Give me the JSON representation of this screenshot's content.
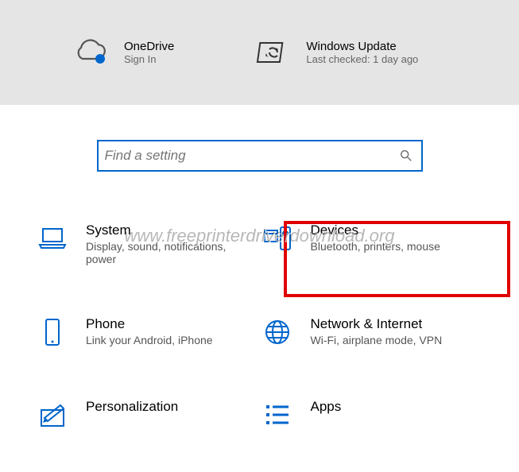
{
  "top": {
    "onedrive": {
      "title": "OneDrive",
      "sub": "Sign In"
    },
    "update": {
      "title": "Windows Update",
      "sub": "Last checked: 1 day ago"
    }
  },
  "search": {
    "placeholder": "Find a setting"
  },
  "tiles": {
    "system": {
      "title": "System",
      "sub": "Display, sound, notifications, power"
    },
    "devices": {
      "title": "Devices",
      "sub": "Bluetooth, printers, mouse"
    },
    "phone": {
      "title": "Phone",
      "sub": "Link your Android, iPhone"
    },
    "network": {
      "title": "Network & Internet",
      "sub": "Wi-Fi, airplane mode, VPN"
    },
    "personalization": {
      "title": "Personalization",
      "sub": ""
    },
    "apps": {
      "title": "Apps",
      "sub": ""
    }
  },
  "watermark": "www.freeprinterdriverdownload.org",
  "colors": {
    "accent": "#0066cc",
    "highlight": "#e00000"
  }
}
